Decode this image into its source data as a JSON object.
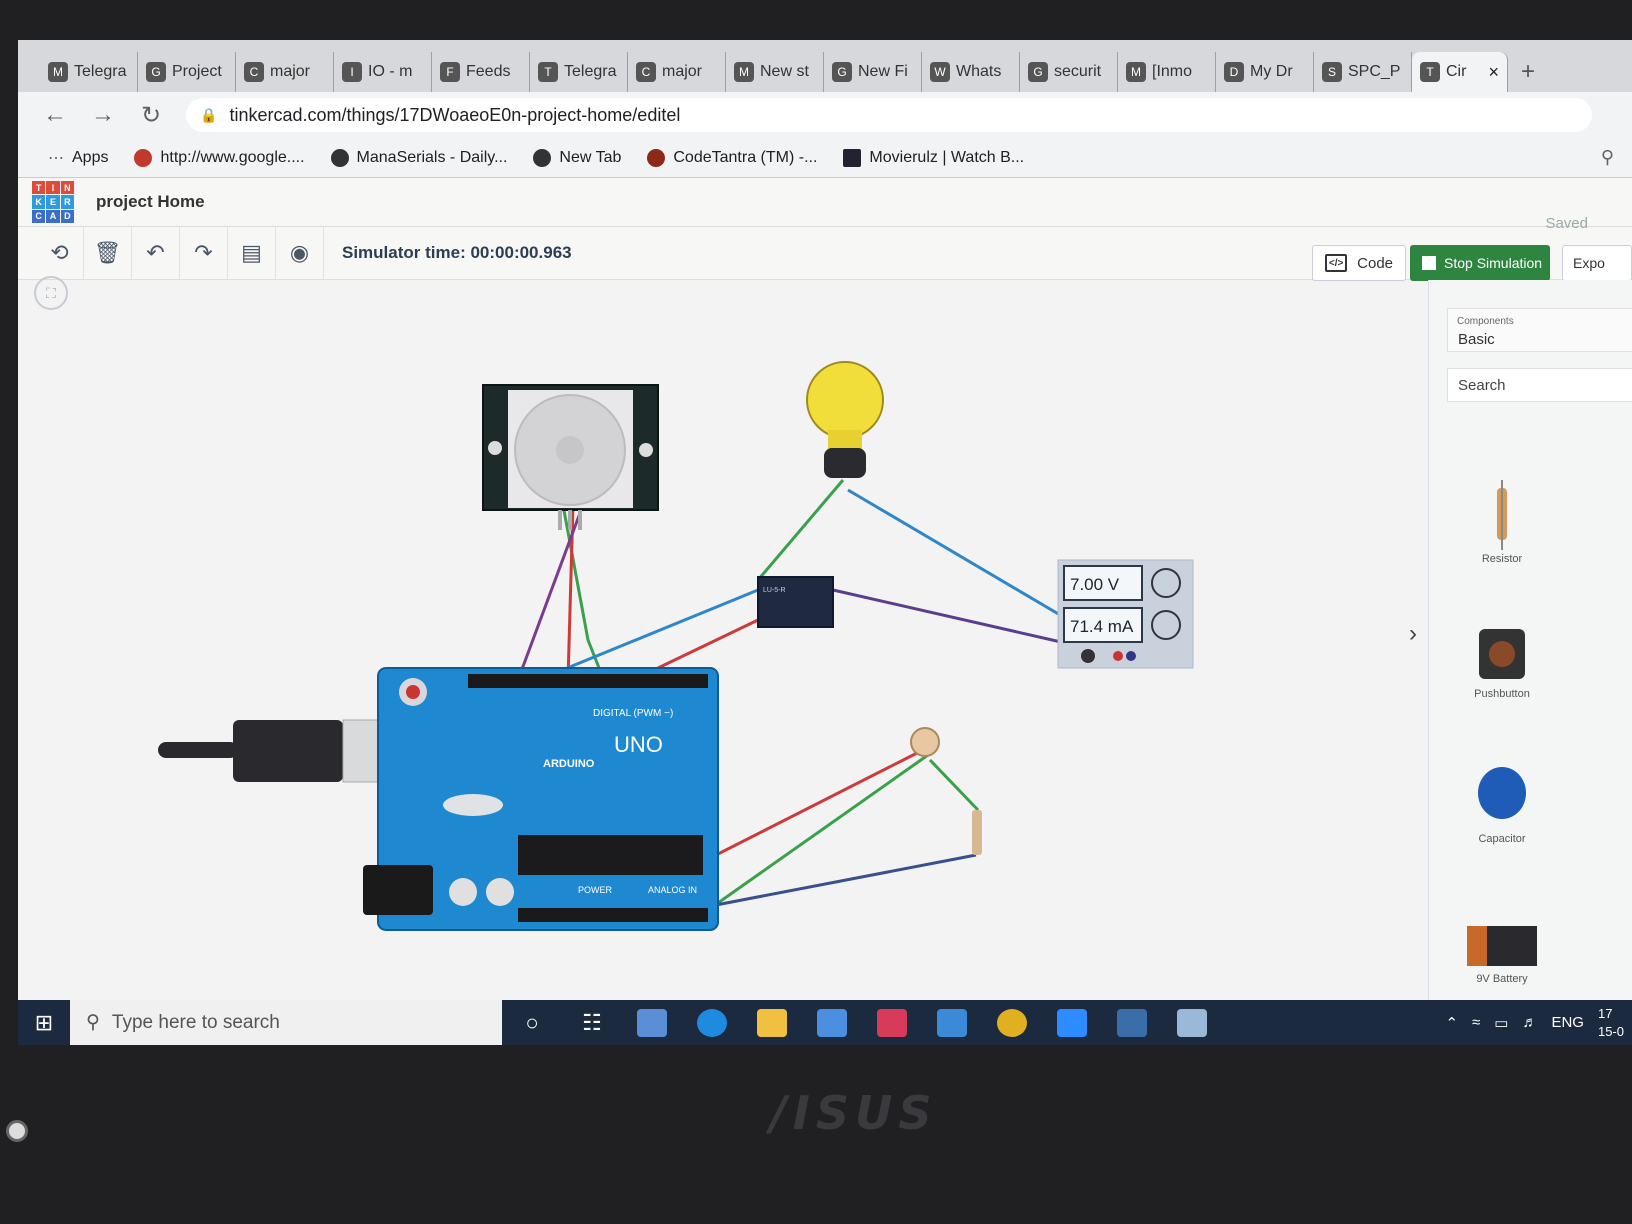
{
  "browser": {
    "tabs": [
      {
        "label": "Telegra",
        "icon": "M"
      },
      {
        "label": "Project",
        "icon": "gh"
      },
      {
        "label": "major",
        "icon": "co"
      },
      {
        "label": "IO - m",
        "icon": "io"
      },
      {
        "label": "Feeds",
        "icon": "fd"
      },
      {
        "label": "Telegra",
        "icon": "tg"
      },
      {
        "label": "major",
        "icon": "co"
      },
      {
        "label": "New st",
        "icon": "M"
      },
      {
        "label": "New Fi",
        "icon": "gh"
      },
      {
        "label": "Whats",
        "icon": "wa"
      },
      {
        "label": "securit",
        "icon": "gh"
      },
      {
        "label": "[Inmo",
        "icon": "M"
      },
      {
        "label": "My Dr",
        "icon": "dr"
      },
      {
        "label": "SPC_P",
        "icon": "sh"
      },
      {
        "label": "Cir",
        "icon": "tk",
        "active": true
      }
    ],
    "new_tab_label": "+",
    "url": "tinkercad.com/things/17DWoaeoE0n-project-home/editel",
    "bookmarks": [
      "Apps",
      "http://www.google....",
      "ManaSerials - Daily...",
      "New Tab",
      "CodeTantra (TM) -...",
      "Movierulz | Watch B..."
    ]
  },
  "tinkercad": {
    "logo_letters": [
      "T",
      "I",
      "N",
      "K",
      "E",
      "R",
      "C",
      "A",
      "D"
    ],
    "project_title": "project Home",
    "saved_label": "Saved",
    "simulator_time": "Simulator time: 00:00:00.963",
    "code_label": "Code",
    "stop_label": "Stop Simulation",
    "export_label": "Expo"
  },
  "multimeter": {
    "voltage": "7.00 V",
    "current": "71.4 mA"
  },
  "board": {
    "brand": "ARDUINO",
    "model": "UNO",
    "digital_label": "DIGITAL (PWM ~)",
    "power_label": "POWER",
    "analog_label": "ANALOG IN",
    "relay_label": "LU-5-R"
  },
  "panel": {
    "components_label": "Components",
    "category": "Basic",
    "search_placeholder": "Search",
    "items": [
      "Resistor",
      "Pushbutton",
      "Capacitor",
      "9V Battery"
    ]
  },
  "taskbar": {
    "search_placeholder": "Type here to search",
    "language": "ENG",
    "time": "17",
    "date": "15-0"
  },
  "laptop_brand": "/ISUS",
  "colors": {
    "stop_button": "#2e8540",
    "arduino_blue": "#1e88d0",
    "wire_green": "#3aa04a",
    "wire_red": "#cc3a3a",
    "wire_blue": "#2f86c8",
    "wire_purple": "#7a3d8c"
  }
}
